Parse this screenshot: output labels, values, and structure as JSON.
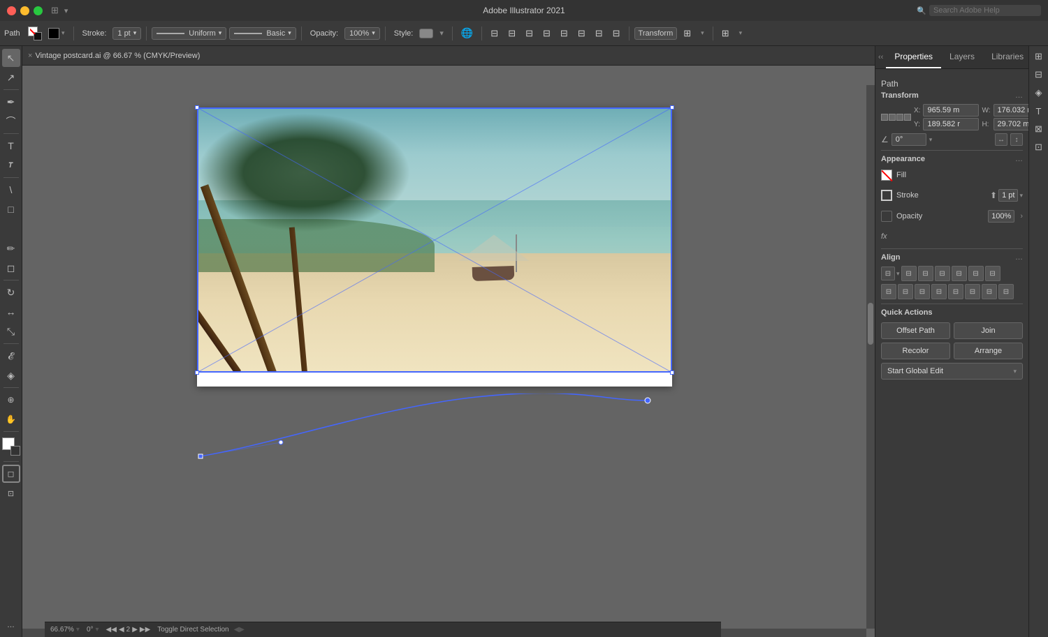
{
  "titlebar": {
    "title": "Adobe Illustrator 2021",
    "window_controls": [
      "red",
      "yellow",
      "green"
    ],
    "search_placeholder": "Search Adobe Help",
    "layout_icon": "⊞",
    "star_icon": "★"
  },
  "toolbar": {
    "path_label": "Path",
    "stroke_label": "Stroke:",
    "stroke_value": "1 pt",
    "stroke_dropdown_arrow": "▾",
    "uniform_label": "Uniform",
    "basic_label": "Basic",
    "opacity_label": "Opacity:",
    "opacity_value": "100%",
    "style_label": "Style:",
    "transform_label": "Transform"
  },
  "tab": {
    "close": "×",
    "name": "Vintage postcard.ai @ 66.67 % (CMYK/Preview)"
  },
  "tools": [
    {
      "name": "select",
      "icon": "↖",
      "active": true
    },
    {
      "name": "direct-select",
      "icon": "↗"
    },
    {
      "name": "pen",
      "icon": "✒"
    },
    {
      "name": "curvature",
      "icon": "⌒"
    },
    {
      "name": "type",
      "icon": "T"
    },
    {
      "name": "line",
      "icon": "\\"
    },
    {
      "name": "rect",
      "icon": "□"
    },
    {
      "name": "paintbrush",
      "icon": "🖌"
    },
    {
      "name": "pencil",
      "icon": "✏"
    },
    {
      "name": "eraser",
      "icon": "◻"
    },
    {
      "name": "scissors",
      "icon": "✂"
    },
    {
      "name": "rotate",
      "icon": "↻"
    },
    {
      "name": "reflect",
      "icon": "↔"
    },
    {
      "name": "scale",
      "icon": "⤡"
    },
    {
      "name": "warp",
      "icon": "⤢"
    },
    {
      "name": "width",
      "icon": "⟺"
    },
    {
      "name": "eyedropper",
      "icon": "💉"
    },
    {
      "name": "blend",
      "icon": "◈"
    },
    {
      "name": "symbol",
      "icon": "⊕"
    },
    {
      "name": "column-graph",
      "icon": "📊"
    },
    {
      "name": "artboard",
      "icon": "⊟"
    },
    {
      "name": "zoom",
      "icon": "🔍"
    },
    {
      "name": "hand",
      "icon": "✋"
    },
    {
      "name": "frame",
      "icon": "⊞"
    },
    {
      "name": "more-tools",
      "icon": "…"
    }
  ],
  "right_panel": {
    "tabs": [
      "Properties",
      "Layers",
      "Libraries"
    ],
    "section_title": "Path",
    "transform": {
      "label": "Transform",
      "x_label": "X:",
      "x_value": "965.59 m",
      "y_label": "Y:",
      "y_value": "189.582 r",
      "w_label": "W:",
      "w_value": "176.032 r",
      "h_label": "H:",
      "h_value": "29.702 m",
      "angle_label": "∠",
      "angle_value": "0°",
      "more_icon": "…"
    },
    "appearance": {
      "label": "Appearance",
      "fill_label": "Fill",
      "stroke_label": "Stroke",
      "stroke_value": "1 pt",
      "opacity_label": "Opacity",
      "opacity_value": "100%",
      "fx_label": "fx",
      "more_icon": "…"
    },
    "align": {
      "label": "Align",
      "more_icon": "…",
      "buttons": [
        "⊞",
        "⊟",
        "⊠",
        "⊡",
        "⊞",
        "⊟",
        "⊠",
        "⊡",
        "⊞",
        "⊟",
        "⊠",
        "⊡",
        "⊞",
        "⊟"
      ]
    },
    "quick_actions": {
      "label": "Quick Actions",
      "offset_path": "Offset Path",
      "join": "Join",
      "recolor": "Recolor",
      "arrange": "Arrange",
      "start_global_edit": "Start Global Edit",
      "dropdown_arrow": "▾"
    }
  },
  "status_bar": {
    "zoom": "66.67%",
    "angle": "0°",
    "page": "2",
    "nav_prev": "◀",
    "nav_first": "◀◀",
    "nav_next": "▶",
    "nav_last": "▶▶",
    "tool_label": "Toggle Direct Selection",
    "artboard_label": "2"
  }
}
